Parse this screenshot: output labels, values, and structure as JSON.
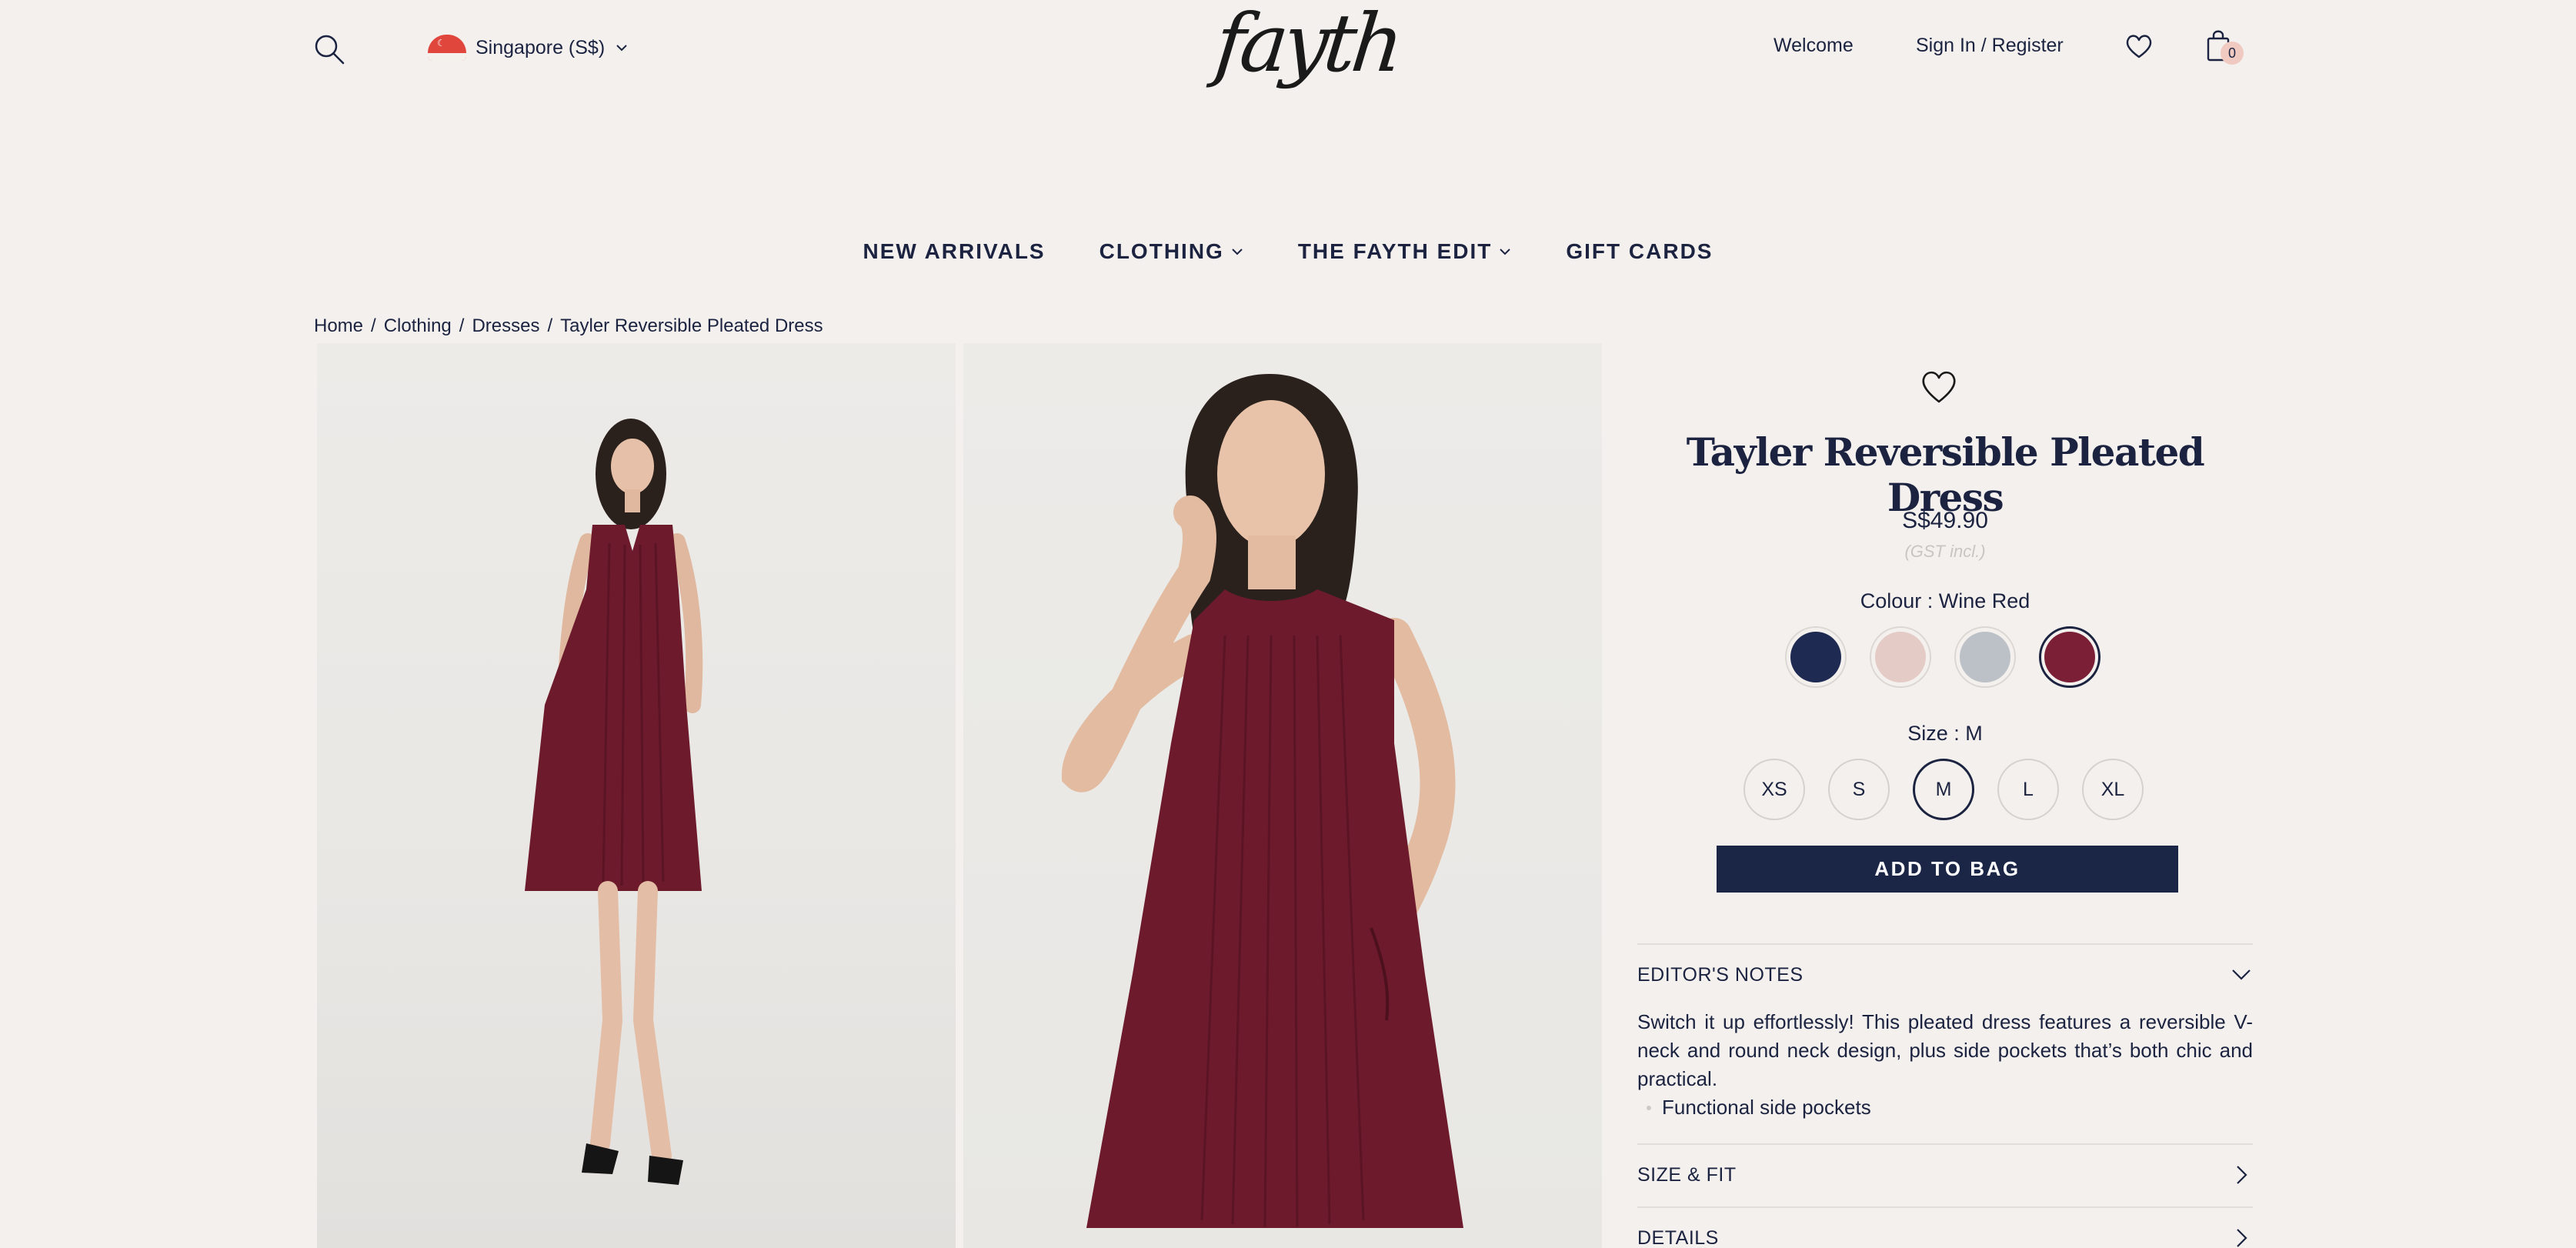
{
  "header": {
    "region_label": "Singapore  (S$)",
    "logo": "fayth",
    "welcome": "Welcome",
    "signin": "Sign In / Register",
    "bag_count": "0"
  },
  "nav": {
    "items": [
      {
        "label": "NEW ARRIVALS",
        "dropdown": false
      },
      {
        "label": "CLOTHING",
        "dropdown": true
      },
      {
        "label": "THE FAYTH EDIT",
        "dropdown": true
      },
      {
        "label": "GIFT CARDS",
        "dropdown": false
      }
    ]
  },
  "breadcrumb": {
    "items": [
      "Home",
      "Clothing",
      "Dresses",
      "Tayler Reversible Pleated Dress"
    ],
    "separator": "/"
  },
  "product": {
    "title": "Tayler Reversible Pleated Dress",
    "price": "S$49.90",
    "gst_note": "(GST incl.)",
    "colour_label": "Colour : Wine Red",
    "colours": [
      {
        "name": "Navy",
        "hex": "#1f2a52",
        "selected": false
      },
      {
        "name": "Blush",
        "hex": "#e4cbc6",
        "selected": false
      },
      {
        "name": "Grey",
        "hex": "#bcc0c7",
        "selected": false
      },
      {
        "name": "Wine Red",
        "hex": "#7a1f35",
        "selected": true
      }
    ],
    "size_label": "Size : M",
    "sizes": [
      {
        "label": "XS",
        "selected": false
      },
      {
        "label": "S",
        "selected": false
      },
      {
        "label": "M",
        "selected": true
      },
      {
        "label": "L",
        "selected": false
      },
      {
        "label": "XL",
        "selected": false
      }
    ],
    "add_to_bag": "ADD TO BAG"
  },
  "accordions": {
    "editors_notes": {
      "title": "EDITOR'S NOTES",
      "body": "Switch it up effortlessly! This pleated dress features a reversible V-neck and round neck design, plus side pockets that’s both chic and practical.",
      "bullet": "Functional side pockets"
    },
    "size_fit": {
      "title": "SIZE & FIT"
    },
    "details": {
      "title": "DETAILS"
    }
  },
  "colors": {
    "brand_navy": "#1b2545",
    "background": "#f3f0ed",
    "dress": "#6d1a2c"
  }
}
